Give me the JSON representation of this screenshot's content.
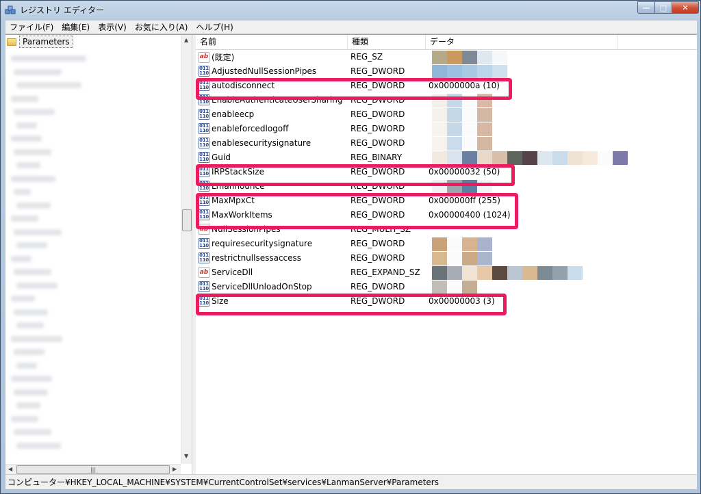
{
  "window": {
    "title": "レジストリ エディター",
    "controls": {
      "minimize": "—",
      "maximize": "□",
      "close": "✕"
    }
  },
  "menu": [
    {
      "label": "ファイル(F)"
    },
    {
      "label": "編集(E)"
    },
    {
      "label": "表示(V)"
    },
    {
      "label": "お気に入り(A)"
    },
    {
      "label": "ヘルプ(H)"
    }
  ],
  "tree": {
    "selected_label": "Parameters"
  },
  "columns": {
    "name": "名前",
    "type": "種類",
    "data": "データ"
  },
  "rows": [
    {
      "name": "(既定)",
      "type": "REG_SZ",
      "data": "",
      "icon": "string-value-icon"
    },
    {
      "name": "AdjustedNullSessionPipes",
      "type": "REG_DWORD",
      "data": "",
      "icon": "binary-value-icon"
    },
    {
      "name": "autodisconnect",
      "type": "REG_DWORD",
      "data": "0x0000000a (10)",
      "icon": "binary-value-icon"
    },
    {
      "name": "EnableAuthenticateUserSharing",
      "type": "REG_DWORD",
      "data": "",
      "icon": "binary-value-icon"
    },
    {
      "name": "enableecp",
      "type": "REG_DWORD",
      "data": "",
      "icon": "binary-value-icon"
    },
    {
      "name": "enableforcedlogoff",
      "type": "REG_DWORD",
      "data": "",
      "icon": "binary-value-icon"
    },
    {
      "name": "enablesecuritysignature",
      "type": "REG_DWORD",
      "data": "",
      "icon": "binary-value-icon"
    },
    {
      "name": "Guid",
      "type": "REG_BINARY",
      "data": "",
      "icon": "binary-value-icon"
    },
    {
      "name": "IRPStackSize",
      "type": "REG_DWORD",
      "data": "0x00000032 (50)",
      "icon": "binary-value-icon"
    },
    {
      "name": "Lmannounce",
      "type": "REG_DWORD",
      "data": "",
      "icon": "binary-value-icon"
    },
    {
      "name": "MaxMpxCt",
      "type": "REG_DWORD",
      "data": "0x000000ff (255)",
      "icon": "binary-value-icon"
    },
    {
      "name": "MaxWorkItems",
      "type": "REG_DWORD",
      "data": "0x00000400 (1024)",
      "icon": "binary-value-icon"
    },
    {
      "name": "NullSessionPipes",
      "type": "REG_MULTI_SZ",
      "data": "",
      "icon": "string-value-icon"
    },
    {
      "name": "requiresecuritysignature",
      "type": "REG_DWORD",
      "data": "",
      "icon": "binary-value-icon"
    },
    {
      "name": "restrictnullsessaccess",
      "type": "REG_DWORD",
      "data": "",
      "icon": "binary-value-icon"
    },
    {
      "name": "ServiceDll",
      "type": "REG_EXPAND_SZ",
      "data": "",
      "icon": "string-value-icon"
    },
    {
      "name": "ServiceDllUnloadOnStop",
      "type": "REG_DWORD",
      "data": "",
      "icon": "binary-value-icon"
    },
    {
      "name": "Size",
      "type": "REG_DWORD",
      "data": "0x00000003 (3)",
      "icon": "binary-value-icon"
    }
  ],
  "status": {
    "path": "コンピューター¥HKEY_LOCAL_MACHINE¥SYSTEM¥CurrentControlSet¥services¥LanmanServer¥Parameters"
  },
  "colors": {
    "highlight": "#ec1b5e"
  }
}
